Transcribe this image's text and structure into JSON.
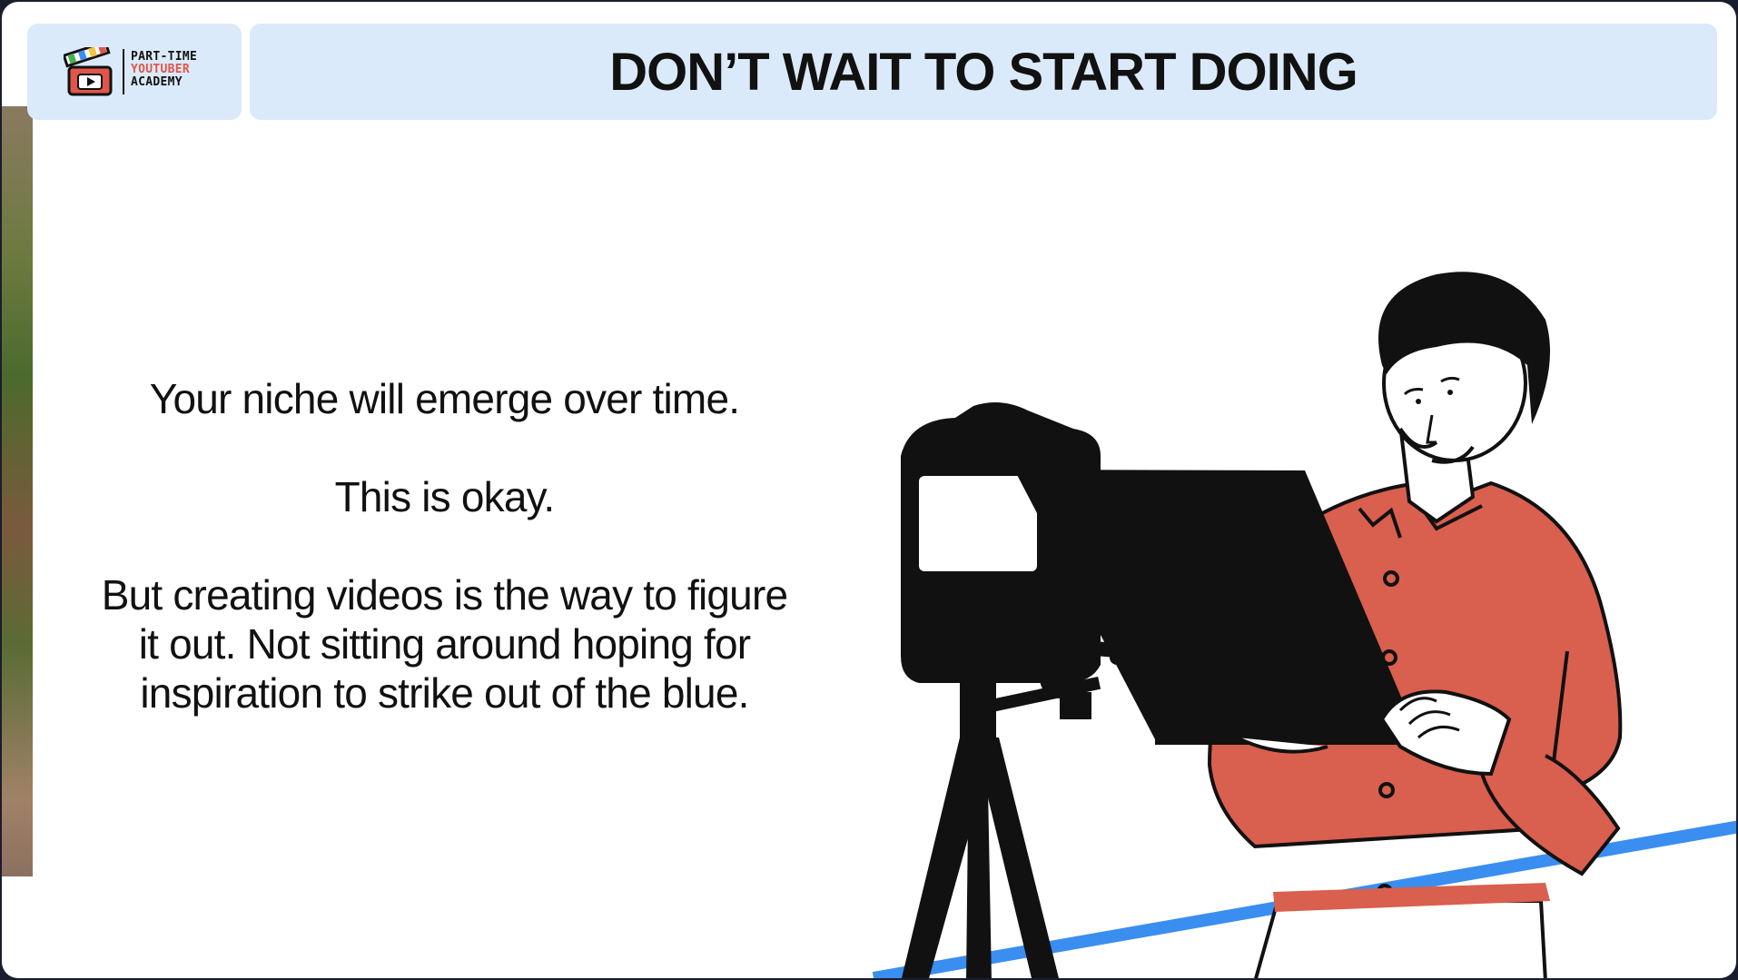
{
  "header": {
    "logo": {
      "line1": "PART-TIME",
      "line2": "YOUTUBER",
      "line3": "ACADEMY",
      "icon": "clapperboard-icon"
    },
    "title": "DON’T WAIT TO START DOING"
  },
  "body": {
    "paragraph1": "Your niche will emerge over time.",
    "paragraph2": "This is okay.",
    "paragraph3_line1": "But creating videos is the way to figure",
    "paragraph3_line2": "it out. Not sitting around hoping for",
    "paragraph3_line3": "inspiration to strike out of the blue."
  },
  "illustration": {
    "subject": "man-with-laptop-and-camera",
    "colors": {
      "shirt": "#d95f4e",
      "accent_line": "#3a8ef0",
      "outline": "#111111"
    }
  },
  "colors": {
    "header_bg": "#dbeafa",
    "logo_red": "#e0564a"
  }
}
